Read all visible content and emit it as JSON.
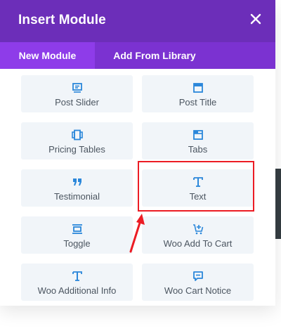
{
  "modal": {
    "title": "Insert Module",
    "close_icon": "close-icon"
  },
  "tabs": [
    {
      "label": "New Module",
      "active": true
    },
    {
      "label": "Add From Library",
      "active": false
    }
  ],
  "modules": [
    {
      "label": "Post Slider",
      "icon": "post-slider-icon"
    },
    {
      "label": "Post Title",
      "icon": "post-title-icon"
    },
    {
      "label": "Pricing Tables",
      "icon": "pricing-tables-icon"
    },
    {
      "label": "Tabs",
      "icon": "tabs-icon"
    },
    {
      "label": "Testimonial",
      "icon": "testimonial-icon"
    },
    {
      "label": "Text",
      "icon": "text-icon"
    },
    {
      "label": "Toggle",
      "icon": "toggle-icon"
    },
    {
      "label": "Woo Add To Cart",
      "icon": "add-to-cart-icon"
    },
    {
      "label": "Woo Additional Info",
      "icon": "text-icon"
    },
    {
      "label": "Woo Cart Notice",
      "icon": "cart-notice-icon"
    }
  ],
  "colors": {
    "header": "#6c2eb9",
    "tabs_bar": "#7b32d1",
    "tab_active": "#8e3ce9",
    "card_bg": "#f1f5f9",
    "icon": "#2b87da",
    "label": "#4b5560",
    "annotation": "#ec1c24"
  }
}
